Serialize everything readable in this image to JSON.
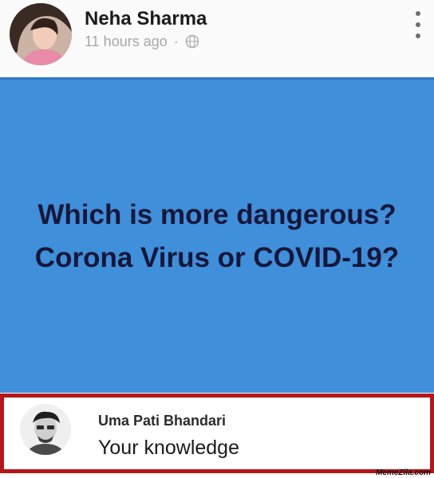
{
  "post": {
    "author": "Neha Sharma",
    "time": "11 hours ago",
    "separator": "·",
    "audience_icon": "globe-icon",
    "menu_icon": "more-vert-icon",
    "background_color": "#3f8fdb",
    "text_lines": [
      "Which is more dangerous?",
      "Corona Virus or COVID-19?"
    ]
  },
  "comment": {
    "author": "Uma Pati Bhandari",
    "text": "Your knowledge",
    "highlight_color": "#b6161b"
  },
  "watermark": "MemeZila.com"
}
